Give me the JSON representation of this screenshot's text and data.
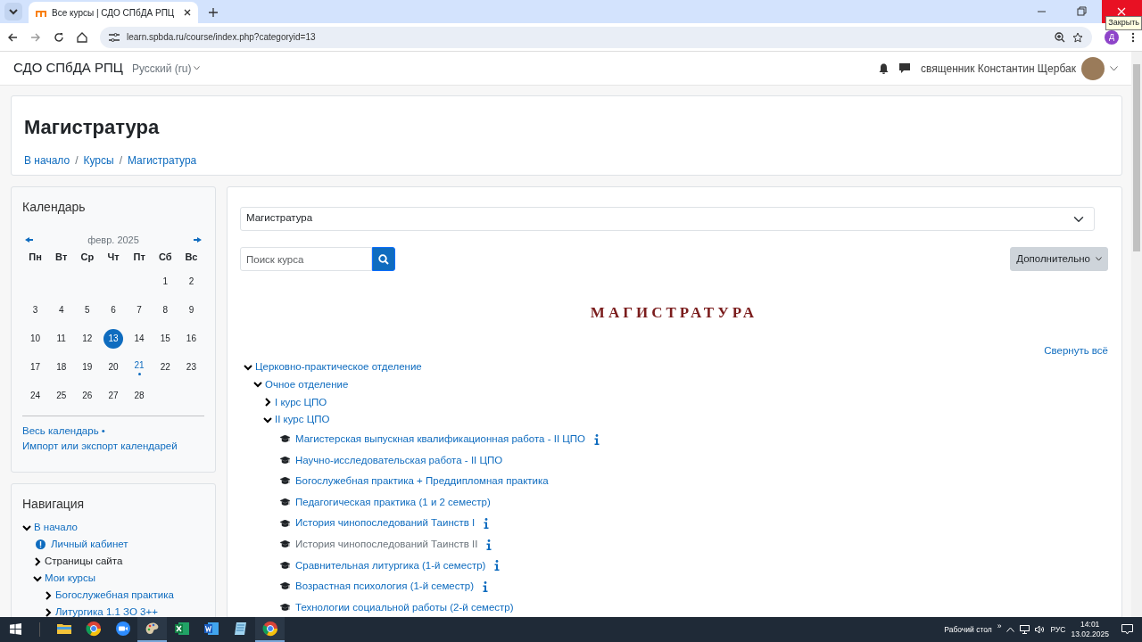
{
  "browser": {
    "tab_title": "Все курсы | СДО СПбДА РПЦ",
    "url": "learn.spbda.ru/course/index.php?categoryid=13",
    "profile_letter": "Д",
    "tooltip": "Закрыть"
  },
  "site": {
    "brand": "СДО СПбДА РПЦ",
    "language": "Русский (ru)",
    "user_name": "священник Константин Щербак"
  },
  "header": {
    "title": "Магистратура",
    "breadcrumb": [
      "В начало",
      "Курсы",
      "Магистратура"
    ],
    "breadcrumb_separator": "/"
  },
  "calendar": {
    "title": "Календарь",
    "month": "февр. 2025",
    "weekdays": [
      "Пн",
      "Вт",
      "Ср",
      "Чт",
      "Пт",
      "Сб",
      "Вс"
    ],
    "weeks": [
      {
        "days": [
          {
            "text": "1",
            "today": false,
            "has_event": false
          },
          {
            "text": "2",
            "today": false,
            "has_event": false
          }
        ]
      },
      {
        "days": [
          {
            "text": "3",
            "today": false,
            "has_event": false
          },
          {
            "text": "4",
            "today": false,
            "has_event": false
          },
          {
            "text": "5",
            "today": false,
            "has_event": false
          },
          {
            "text": "6",
            "today": false,
            "has_event": false
          },
          {
            "text": "7",
            "today": false,
            "has_event": false
          },
          {
            "text": "8",
            "today": false,
            "has_event": false
          },
          {
            "text": "9",
            "today": false,
            "has_event": false
          }
        ]
      },
      {
        "days": [
          {
            "text": "10",
            "today": false,
            "has_event": false
          },
          {
            "text": "11",
            "today": false,
            "has_event": false
          },
          {
            "text": "12",
            "today": false,
            "has_event": false
          },
          {
            "text": "13",
            "today": true,
            "has_event": false
          },
          {
            "text": "14",
            "today": false,
            "has_event": false
          },
          {
            "text": "15",
            "today": false,
            "has_event": false
          },
          {
            "text": "16",
            "today": false,
            "has_event": false
          }
        ]
      },
      {
        "days": [
          {
            "text": "17",
            "today": false,
            "has_event": false
          },
          {
            "text": "18",
            "today": false,
            "has_event": false
          },
          {
            "text": "19",
            "today": false,
            "has_event": false
          },
          {
            "text": "20",
            "today": false,
            "has_event": false
          },
          {
            "text": "21",
            "today": false,
            "has_event": true
          },
          {
            "text": "22",
            "today": false,
            "has_event": false
          },
          {
            "text": "23",
            "today": false,
            "has_event": false
          }
        ]
      },
      {
        "days": [
          {
            "text": "24",
            "today": false,
            "has_event": false
          },
          {
            "text": "25",
            "today": false,
            "has_event": false
          },
          {
            "text": "26",
            "today": false,
            "has_event": false
          },
          {
            "text": "27",
            "today": false,
            "has_event": false
          },
          {
            "text": "28",
            "today": false,
            "has_event": false
          }
        ]
      }
    ],
    "links": [
      "Весь календарь",
      "Импорт или экспорт календарей"
    ],
    "separator": "•"
  },
  "navigation": {
    "title": "Навигация",
    "items": [
      {
        "label": "В начало",
        "kind": "link",
        "expanded": true,
        "children": [
          {
            "label": "Личный кабинет",
            "kind": "dashboard"
          },
          {
            "label": "Страницы сайта",
            "kind": "text",
            "expanded": false
          },
          {
            "label": "Мои курсы",
            "kind": "link",
            "expanded": true,
            "children": [
              {
                "label": "Богослужебная практика",
                "kind": "link",
                "expanded": false
              },
              {
                "label": "Литургика 1.1 ЗО 3++",
                "kind": "link",
                "expanded": false
              }
            ]
          }
        ]
      }
    ]
  },
  "main": {
    "category_select": "Магистратура",
    "search_placeholder": "Поиск курса",
    "more_button": "Дополнительно",
    "heading": "МАГИСТРАТУРА",
    "collapse_all": "Свернуть всё",
    "tree": [
      {
        "label": "Церковно-практическое отделение",
        "kind": "category",
        "expanded": true,
        "children": [
          {
            "label": "Очное отделение",
            "kind": "category",
            "expanded": true,
            "children": [
              {
                "label": "I курс ЦПО",
                "kind": "category",
                "expanded": false
              },
              {
                "label": "II курс ЦПО",
                "kind": "category",
                "expanded": true,
                "children": [
                  {
                    "label": "Магистерская выпускная квалификационная работа - II ЦПО",
                    "kind": "course",
                    "info": true,
                    "dimmed": false
                  },
                  {
                    "label": "Научно-исследовательская работа - II ЦПО",
                    "kind": "course",
                    "info": false,
                    "dimmed": false
                  },
                  {
                    "label": "Богослужебная практика + Преддипломная практика",
                    "kind": "course",
                    "info": false,
                    "dimmed": false
                  },
                  {
                    "label": "Педагогическая практика (1 и 2 семестр)",
                    "kind": "course",
                    "info": false,
                    "dimmed": false
                  },
                  {
                    "label": "История чинопоследований Таинств I",
                    "kind": "course",
                    "info": true,
                    "dimmed": false
                  },
                  {
                    "label": "История чинопоследований Таинств II",
                    "kind": "course",
                    "info": true,
                    "dimmed": true
                  },
                  {
                    "label": "Сравнительная литургика (1-й семестр)",
                    "kind": "course",
                    "info": true,
                    "dimmed": false
                  },
                  {
                    "label": "Возрастная психология (1-й семестр)",
                    "kind": "course",
                    "info": true,
                    "dimmed": false
                  },
                  {
                    "label": "Технологии социальной работы (2-й семестр)",
                    "kind": "course",
                    "info": false,
                    "dimmed": false
                  }
                ]
              }
            ]
          }
        ]
      }
    ]
  },
  "taskbar": {
    "apps": [
      {
        "kind": "folder",
        "running": false
      },
      {
        "kind": "browser",
        "running": false
      },
      {
        "kind": "video",
        "running": false
      },
      {
        "kind": "paint",
        "running": true
      },
      {
        "kind": "sheet",
        "running": false
      },
      {
        "kind": "doc",
        "running": false
      },
      {
        "kind": "notes",
        "running": false
      },
      {
        "kind": "browser",
        "running": true
      }
    ],
    "desktop_label": "Рабочий стол",
    "chevrons": "»",
    "language": "РУС",
    "time": "14:01",
    "date": "13.02.2025"
  }
}
